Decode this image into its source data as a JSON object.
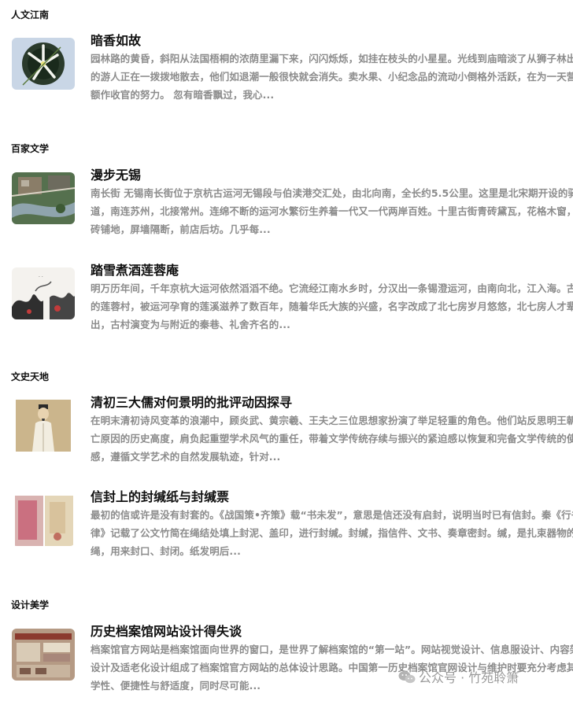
{
  "sections": [
    {
      "title": "人文江南",
      "articles": [
        {
          "title": "暗香如故",
          "excerpt": "园林路的黄昏，斜阳从法国梧桐的浓荫里漏下来，闪闪烁烁，如挂在枝头的小星星。光线到庙暗淡了从狮子林出来的游人正在一拨拨地散去，他们如退潮一般很快就会消失。卖水果、小纪念品的流动小倒格外活跃，在为一天营业额作收官的努力。 忽有暗香飘过，我心...",
          "thumb_icon": "orchid-flower-image"
        }
      ]
    },
    {
      "title": "百家文学",
      "articles": [
        {
          "title": "漫步无锡",
          "excerpt": "南长街 无锡南长街位于京杭古运河无锡段与伯渎港交汇处，由北向南，全长约5.5公里。这里是北宋期开设的驿道，南连苏州，北接常州。连绵不断的运河水繁衍生养着一代又一代两岸百姓。十里古街青砖黛瓦，花格木窗，方砖铺地，屏墙隔断，前店后坊。几乎每...",
          "thumb_icon": "aerial-canal-image"
        },
        {
          "title": "踏雪煮酒莲蓉庵",
          "excerpt": "明万历年间，千年京杭大运河依然滔滔不绝。它流经江南水乡时，分汉出一条锡澄运河，由南向北，江入海。古老的莲蓉村，被运河孕育的莲溪滋养了数百年，随着华氏大族的兴盛，名字改成了北七房岁月悠悠，北七房人才辈出，古村演变为与附近的秦巷、礼舍齐名的...",
          "thumb_icon": "ink-painting-image"
        }
      ]
    },
    {
      "title": "文史天地",
      "articles": [
        {
          "title": "清初三大儒对何景明的批评动因探寻",
          "excerpt": "在明末清初诗风变革的浪潮中，顾炎武、黄宗羲、王夫之三位思想家扮演了举足轻重的角色。他们站反思明王朝灭亡原因的历史高度，肩负起重塑学术风气的重任，带着文学传统存续与振兴的紧迫感以恢复和完备文学传统的使命感，遵循文学艺术的自然发展轨迹，针对...",
          "thumb_icon": "scholar-portrait-image"
        },
        {
          "title": "信封上的封缄纸与封缄票",
          "excerpt": "最初的信或许是没有封套的。《战国策•齐策》载“书未发”，意思是信还没有启封，说明当时已有信封。秦《行书律》记载了公文竹简在绳结处填上封泥、盖印，进行封缄。封缄，指信件、文书、奏章密封。缄，是扎束器物的绳，用来封口、封闭。纸发明后...",
          "thumb_icon": "envelope-seal-image"
        }
      ]
    },
    {
      "title": "设计美学",
      "articles": [
        {
          "title": "历史档案馆网站设计得失谈",
          "excerpt": "档案馆官方网站是档案馆面向世界的窗口，是世界了解档案馆的“第一站”。网站视觉设计、信息服设计、内容架构设计及适老化设计组成了档案馆官方网站的总体设计思路。中国第一历史档案馆官网设计与维护时要充分考虑其科学性、便捷性与舒适度，同时尽可能...",
          "thumb_icon": "archive-website-image"
        }
      ]
    }
  ],
  "watermark": {
    "text": "公众号 · 竹苑聆箫",
    "icon": "wechat-icon"
  }
}
